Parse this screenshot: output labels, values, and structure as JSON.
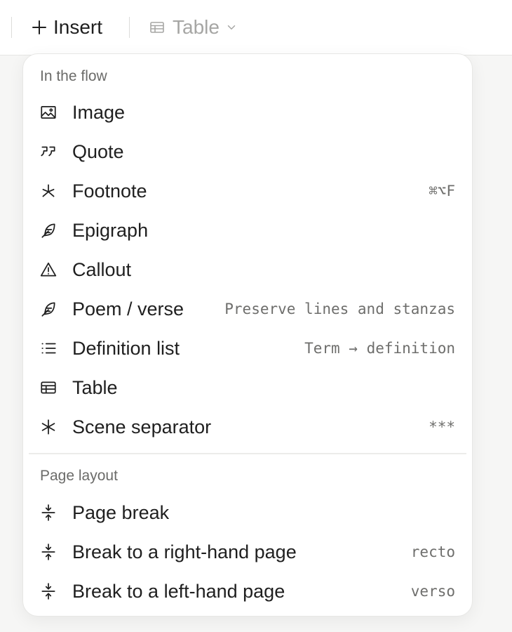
{
  "toolbar": {
    "insert_label": "Insert",
    "table_label": "Table"
  },
  "menu": {
    "sections": [
      {
        "label": "In the flow",
        "items": [
          {
            "label": "Image",
            "hint": "",
            "icon": "image-icon"
          },
          {
            "label": "Quote",
            "hint": "",
            "icon": "quote-icon"
          },
          {
            "label": "Footnote",
            "hint": "⌘⌥F",
            "icon": "asterisk-icon"
          },
          {
            "label": "Epigraph",
            "hint": "",
            "icon": "feather-icon"
          },
          {
            "label": "Callout",
            "hint": "",
            "icon": "warning-triangle-icon"
          },
          {
            "label": "Poem / verse",
            "hint": "Preserve lines and stanzas",
            "icon": "feather-icon"
          },
          {
            "label": "Definition list",
            "hint": "Term → definition",
            "icon": "list-icon"
          },
          {
            "label": "Table",
            "hint": "",
            "icon": "table-icon"
          },
          {
            "label": "Scene separator",
            "hint": "***",
            "icon": "asterisk-bold-icon"
          }
        ]
      },
      {
        "label": "Page layout",
        "items": [
          {
            "label": "Page break",
            "hint": "",
            "icon": "page-break-icon"
          },
          {
            "label": "Break to a right-hand page",
            "hint": "recto",
            "icon": "page-break-icon"
          },
          {
            "label": "Break to a left-hand page",
            "hint": "verso",
            "icon": "page-break-icon"
          }
        ]
      }
    ]
  },
  "colors": {
    "text": "#1f1f1f",
    "muted": "#6b6b69",
    "disabled": "#a6a6a4",
    "background": "#f6f6f5",
    "menu_bg": "#ffffff"
  }
}
